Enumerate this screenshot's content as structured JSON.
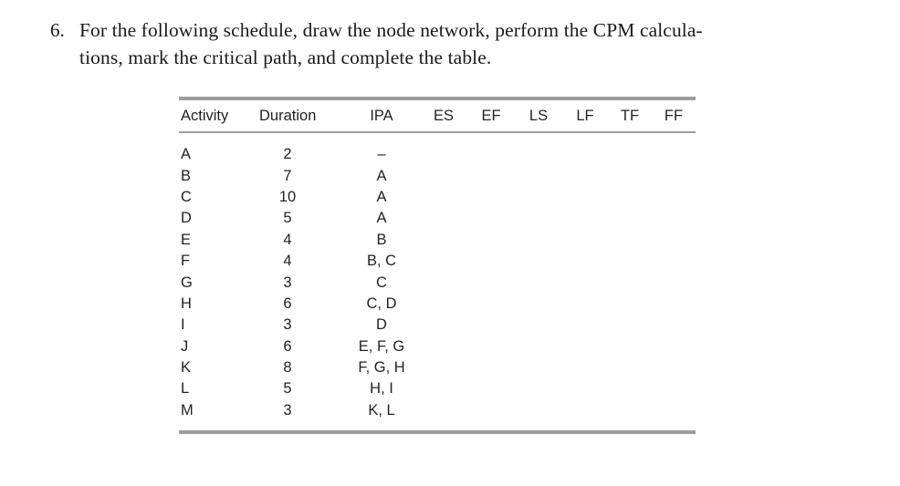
{
  "question": {
    "number": "6.",
    "lines": [
      "For the following schedule, draw the node network, perform the CPM calcula-",
      "tions, mark the critical path, and complete the table."
    ]
  },
  "table": {
    "columns": [
      {
        "key": "activity",
        "label": "Activity"
      },
      {
        "key": "duration",
        "label": "Duration"
      },
      {
        "key": "ipa",
        "label": "IPA"
      },
      {
        "key": "es",
        "label": "ES"
      },
      {
        "key": "ef",
        "label": "EF"
      },
      {
        "key": "ls",
        "label": "LS"
      },
      {
        "key": "lf",
        "label": "LF"
      },
      {
        "key": "tf",
        "label": "TF"
      },
      {
        "key": "ff",
        "label": "FF"
      }
    ],
    "rows": [
      {
        "activity": "A",
        "duration": "2",
        "ipa": "–",
        "es": "",
        "ef": "",
        "ls": "",
        "lf": "",
        "tf": "",
        "ff": ""
      },
      {
        "activity": "B",
        "duration": "7",
        "ipa": "A",
        "es": "",
        "ef": "",
        "ls": "",
        "lf": "",
        "tf": "",
        "ff": ""
      },
      {
        "activity": "C",
        "duration": "10",
        "ipa": "A",
        "es": "",
        "ef": "",
        "ls": "",
        "lf": "",
        "tf": "",
        "ff": ""
      },
      {
        "activity": "D",
        "duration": "5",
        "ipa": "A",
        "es": "",
        "ef": "",
        "ls": "",
        "lf": "",
        "tf": "",
        "ff": ""
      },
      {
        "activity": "E",
        "duration": "4",
        "ipa": "B",
        "es": "",
        "ef": "",
        "ls": "",
        "lf": "",
        "tf": "",
        "ff": ""
      },
      {
        "activity": "F",
        "duration": "4",
        "ipa": "B, C",
        "es": "",
        "ef": "",
        "ls": "",
        "lf": "",
        "tf": "",
        "ff": ""
      },
      {
        "activity": "G",
        "duration": "3",
        "ipa": "C",
        "es": "",
        "ef": "",
        "ls": "",
        "lf": "",
        "tf": "",
        "ff": ""
      },
      {
        "activity": "H",
        "duration": "6",
        "ipa": "C, D",
        "es": "",
        "ef": "",
        "ls": "",
        "lf": "",
        "tf": "",
        "ff": ""
      },
      {
        "activity": "I",
        "duration": "3",
        "ipa": "D",
        "es": "",
        "ef": "",
        "ls": "",
        "lf": "",
        "tf": "",
        "ff": ""
      },
      {
        "activity": "J",
        "duration": "6",
        "ipa": "E, F, G",
        "es": "",
        "ef": "",
        "ls": "",
        "lf": "",
        "tf": "",
        "ff": ""
      },
      {
        "activity": "K",
        "duration": "8",
        "ipa": "F, G, H",
        "es": "",
        "ef": "",
        "ls": "",
        "lf": "",
        "tf": "",
        "ff": ""
      },
      {
        "activity": "L",
        "duration": "5",
        "ipa": "H, I",
        "es": "",
        "ef": "",
        "ls": "",
        "lf": "",
        "tf": "",
        "ff": ""
      },
      {
        "activity": "M",
        "duration": "3",
        "ipa": "K, L",
        "es": "",
        "ef": "",
        "ls": "",
        "lf": "",
        "tf": "",
        "ff": ""
      }
    ]
  },
  "colors": {
    "rule": "#9d9d9d",
    "text": "#231f20",
    "background": "#ffffff"
  }
}
